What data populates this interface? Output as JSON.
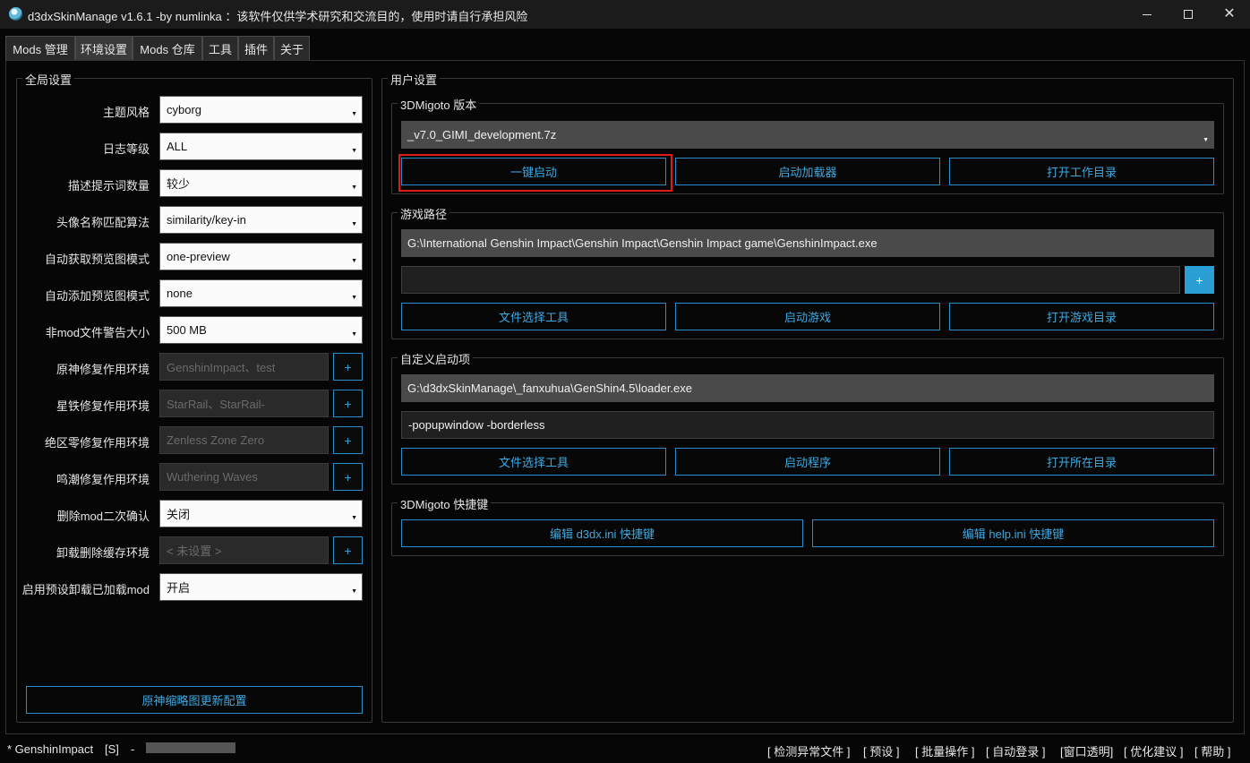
{
  "window": {
    "title": "d3dxSkinManage v1.6.1 -by numlinka ：该软件仅供学术研究和交流目的，使用时请自行承担风险",
    "controls": {
      "minimize": "—",
      "maximize": "□",
      "close": "✕"
    }
  },
  "tabs": [
    {
      "label": "Mods 管理"
    },
    {
      "label": "环境设置"
    },
    {
      "label": "Mods 仓库"
    },
    {
      "label": "工具"
    },
    {
      "label": "插件"
    },
    {
      "label": "关于"
    }
  ],
  "global": {
    "title": "全局设置",
    "rows": [
      {
        "label": "主题风格",
        "value": "cyborg"
      },
      {
        "label": "日志等级",
        "value": "ALL"
      },
      {
        "label": "描述提示词数量",
        "value": "较少"
      },
      {
        "label": "头像名称匹配算法",
        "value": "similarity/key-in"
      },
      {
        "label": "自动获取预览图模式",
        "value": "one-preview"
      },
      {
        "label": "自动添加预览图模式",
        "value": "none"
      },
      {
        "label": "非mod文件警告大小",
        "value": "500 MB"
      }
    ],
    "envRows": [
      {
        "label": "原神修复作用环境",
        "placeholder": "GenshinImpact、test"
      },
      {
        "label": "星铁修复作用环境",
        "placeholder": "StarRail、StarRail-"
      },
      {
        "label": "绝区零修复作用环境",
        "placeholder": "Zenless Zone Zero"
      },
      {
        "label": "鸣潮修复作用环境",
        "placeholder": "Wuthering Waves"
      }
    ],
    "deleteConfirm": {
      "label": "删除mod二次确认",
      "value": "关闭"
    },
    "unloadCache": {
      "label": "卸载删除缓存环境",
      "placeholder": "< 未设置 >"
    },
    "preUnload": {
      "label": "启用预设卸载已加载mod",
      "value": "开启"
    },
    "plus": "+",
    "bottomButton": "原神缩略图更新配置"
  },
  "user": {
    "title": "用户设置",
    "migoto": {
      "title": "3DMigoto 版本",
      "version": "_v7.0_GIMI_development.7z",
      "buttons": [
        "一键启动",
        "启动加载器",
        "打开工作目录"
      ]
    },
    "gamePath": {
      "title": "游戏路径",
      "path": "G:\\International Genshin Impact\\Genshin Impact\\Genshin Impact game\\GenshinImpact.exe",
      "extra": "",
      "plus": "+",
      "buttons": [
        "文件选择工具",
        "启动游戏",
        "打开游戏目录"
      ]
    },
    "custom": {
      "title": "自定义启动项",
      "path": "G:\\d3dxSkinManage\\_fanxuhua\\GenShin4.5\\loader.exe",
      "args": "-popupwindow -borderless",
      "buttons": [
        "文件选择工具",
        "启动程序",
        "打开所在目录"
      ]
    },
    "hotkeys": {
      "title": "3DMigoto 快捷键",
      "buttons": [
        "编辑 d3dx.ini 快捷键",
        "编辑 help.ini 快捷键"
      ]
    }
  },
  "status": {
    "env": "* GenshinImpact",
    "profile": "[S]",
    "dash": "-",
    "links": [
      "[ 检测异常文件 ]",
      "[ 预设 ]",
      "[ 批量操作 ]",
      "[ 自动登录 ]",
      "[窗口透明]",
      "[ 优化建议 ]",
      "[ 帮助 ]"
    ]
  },
  "colors": {
    "accent": "#2a9fd6",
    "highlight": "#e01a1a",
    "background": "#060606"
  }
}
